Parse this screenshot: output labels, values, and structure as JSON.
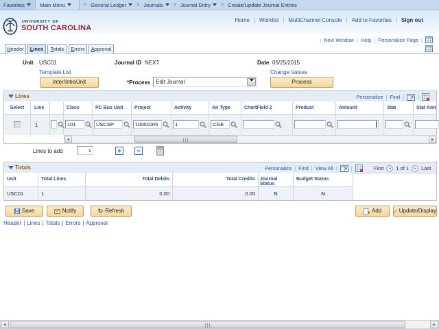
{
  "breadcrumb": {
    "favorites": "Favorites",
    "main_menu": "Main Menu",
    "items": [
      "General Ledger",
      "Journals",
      "Journal Entry"
    ],
    "current": "Create/Update Journal Entries"
  },
  "header": {
    "university_line1": "UNIVERSITY OF",
    "university_line2": "SOUTH CAROLINA",
    "links": [
      "Home",
      "Worklist",
      "MultiChannel Console",
      "Add to Favorites"
    ],
    "sign_out": "Sign out"
  },
  "pagebar": {
    "links": [
      "New Window",
      "Help",
      "Personalize Page"
    ]
  },
  "tabs": {
    "items": [
      "Header",
      "Lines",
      "Totals",
      "Errors",
      "Approval"
    ],
    "active": "Lines"
  },
  "journal_header": {
    "unit_label": "Unit",
    "unit_value": "USC01",
    "journal_id_label": "Journal ID",
    "journal_id_value": "NEXT",
    "date_label": "Date",
    "date_value": "05/25/2015",
    "template_list_link": "Template List",
    "change_values_link": "Change Values",
    "inter_intra_button": "Inter/IntraUnit",
    "process_label": "*Process",
    "process_value": "Edit Journal",
    "process_button": "Process"
  },
  "lines": {
    "title": "Lines",
    "personalize_link": "Personalize",
    "find_link": "Find",
    "columns": [
      "Select",
      "Line",
      "Class",
      "PC Bus Unit",
      "Project",
      "Activity",
      "An Type",
      "ChartField 2",
      "Product",
      "Amount",
      "Stat",
      "Stat Amt"
    ],
    "row": {
      "line": "1",
      "class": "101",
      "pc_bus_unit": "USCSP",
      "project": "10001005",
      "activity": "1",
      "an_type": "CGE",
      "chartfield2": "",
      "product": "",
      "amount": "",
      "stat": "",
      "stat_amt": ""
    },
    "lines_to_add_label": "Lines to add",
    "lines_to_add_value": "1"
  },
  "totals": {
    "title": "Totals",
    "personalize_link": "Personalize",
    "find_link": "Find",
    "view_all_link": "View All",
    "pager": {
      "first": "First",
      "position": "1 of 1",
      "last": "Last"
    },
    "columns": [
      "Unit",
      "Total Lines",
      "Total Debits",
      "Total Credits",
      "Journal Status",
      "Budget Status"
    ],
    "row": {
      "unit": "USC01",
      "total_lines": "1",
      "total_debits": "0.00",
      "total_credits": "0.00",
      "journal_status": "N",
      "budget_status": "N"
    }
  },
  "toolbar": {
    "save": "Save",
    "notify": "Notify",
    "refresh": "Refresh",
    "add": "Add",
    "update_display": "Update/Display"
  },
  "footer": {
    "links": [
      "Header",
      "Lines",
      "Totals",
      "Errors",
      "Approval"
    ]
  }
}
